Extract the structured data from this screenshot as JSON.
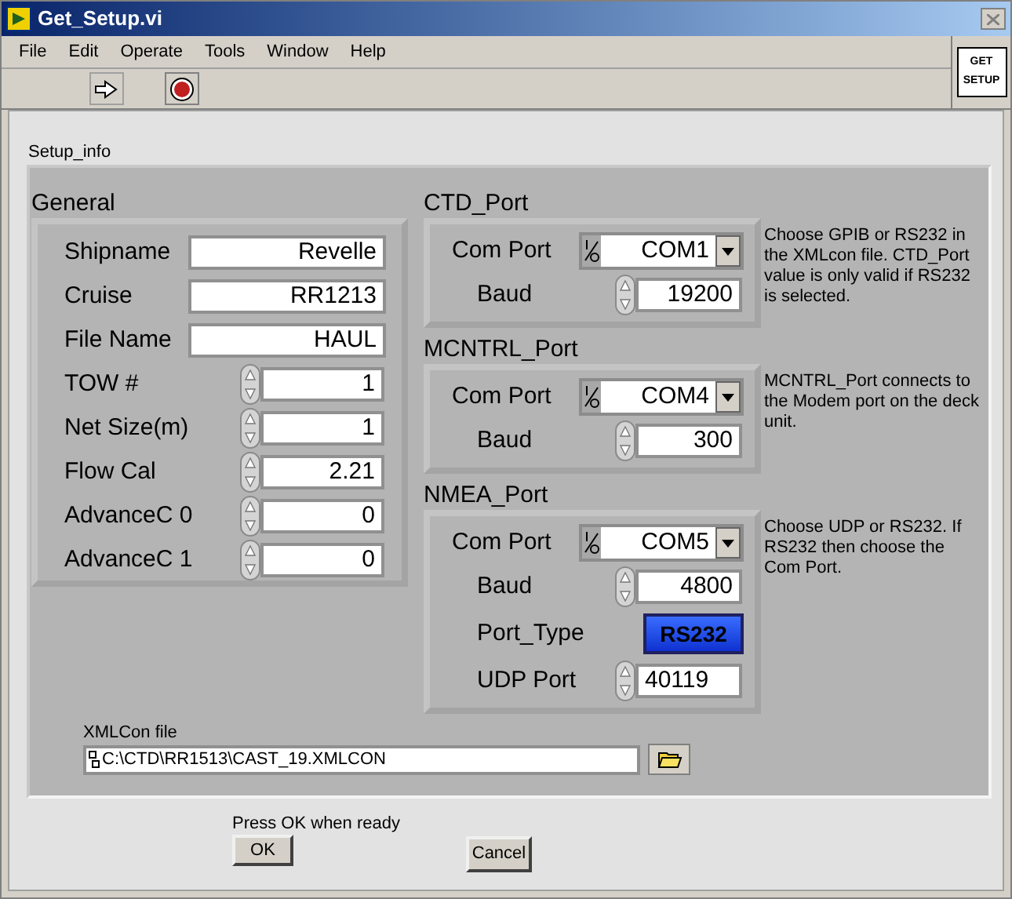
{
  "window": {
    "title": "Get_Setup.vi"
  },
  "menu": [
    {
      "label": "File"
    },
    {
      "label": "Edit"
    },
    {
      "label": "Operate"
    },
    {
      "label": "Tools"
    },
    {
      "label": "Window"
    },
    {
      "label": "Help"
    }
  ],
  "vi_icon": {
    "lines": [
      "GET",
      "SETUP"
    ]
  },
  "cluster": {
    "label": "Setup_info"
  },
  "general": {
    "label": "General",
    "fields": [
      {
        "kind": "text",
        "label": "Shipname",
        "value": "Revelle"
      },
      {
        "kind": "text",
        "label": "Cruise",
        "value": "RR1213"
      },
      {
        "kind": "text",
        "label": "File Name",
        "value": "HAUL"
      },
      {
        "kind": "numeric",
        "label": "TOW #",
        "value": "1"
      },
      {
        "kind": "numeric",
        "label": "Net Size(m)",
        "value": "1"
      },
      {
        "kind": "numeric",
        "label": "Flow Cal",
        "value": "2.21"
      },
      {
        "kind": "numeric",
        "label": "AdvanceC 0",
        "value": "0"
      },
      {
        "kind": "numeric",
        "label": "AdvanceC 1",
        "value": "0"
      }
    ]
  },
  "ports": [
    {
      "label": "CTD_Port",
      "note": "Choose GPIB or RS232 in the XMLcon file. CTD_Port value is only valid if RS232 is selected.",
      "rows": [
        {
          "kind": "ring",
          "label": "Com Port",
          "value": "COM1"
        },
        {
          "kind": "numeric",
          "label": "Baud",
          "value": "19200"
        }
      ]
    },
    {
      "label": "MCNTRL_Port",
      "note": "MCNTRL_Port connects to the Modem port on the deck unit.",
      "rows": [
        {
          "kind": "ring",
          "label": "Com Port",
          "value": "COM4"
        },
        {
          "kind": "numeric",
          "label": "Baud",
          "value": "300"
        }
      ]
    },
    {
      "label": "NMEA_Port",
      "note": "Choose UDP or RS232. If RS232 then choose the Com Port.",
      "rows": [
        {
          "kind": "ring",
          "label": "Com Port",
          "value": "COM5"
        },
        {
          "kind": "numeric",
          "label": "Baud",
          "value": "4800"
        },
        {
          "kind": "toggle",
          "label": "Port_Type",
          "value": "RS232"
        },
        {
          "kind": "entry",
          "label": "UDP Port",
          "value": "40119"
        }
      ]
    }
  ],
  "xmlcon": {
    "label": "XMLCon file",
    "path": "C:\\CTD\\RR1513\\CAST_19.XMLCON"
  },
  "prompt": "Press OK when ready",
  "buttons": [
    {
      "label": "OK"
    },
    {
      "label": "Cancel"
    }
  ]
}
